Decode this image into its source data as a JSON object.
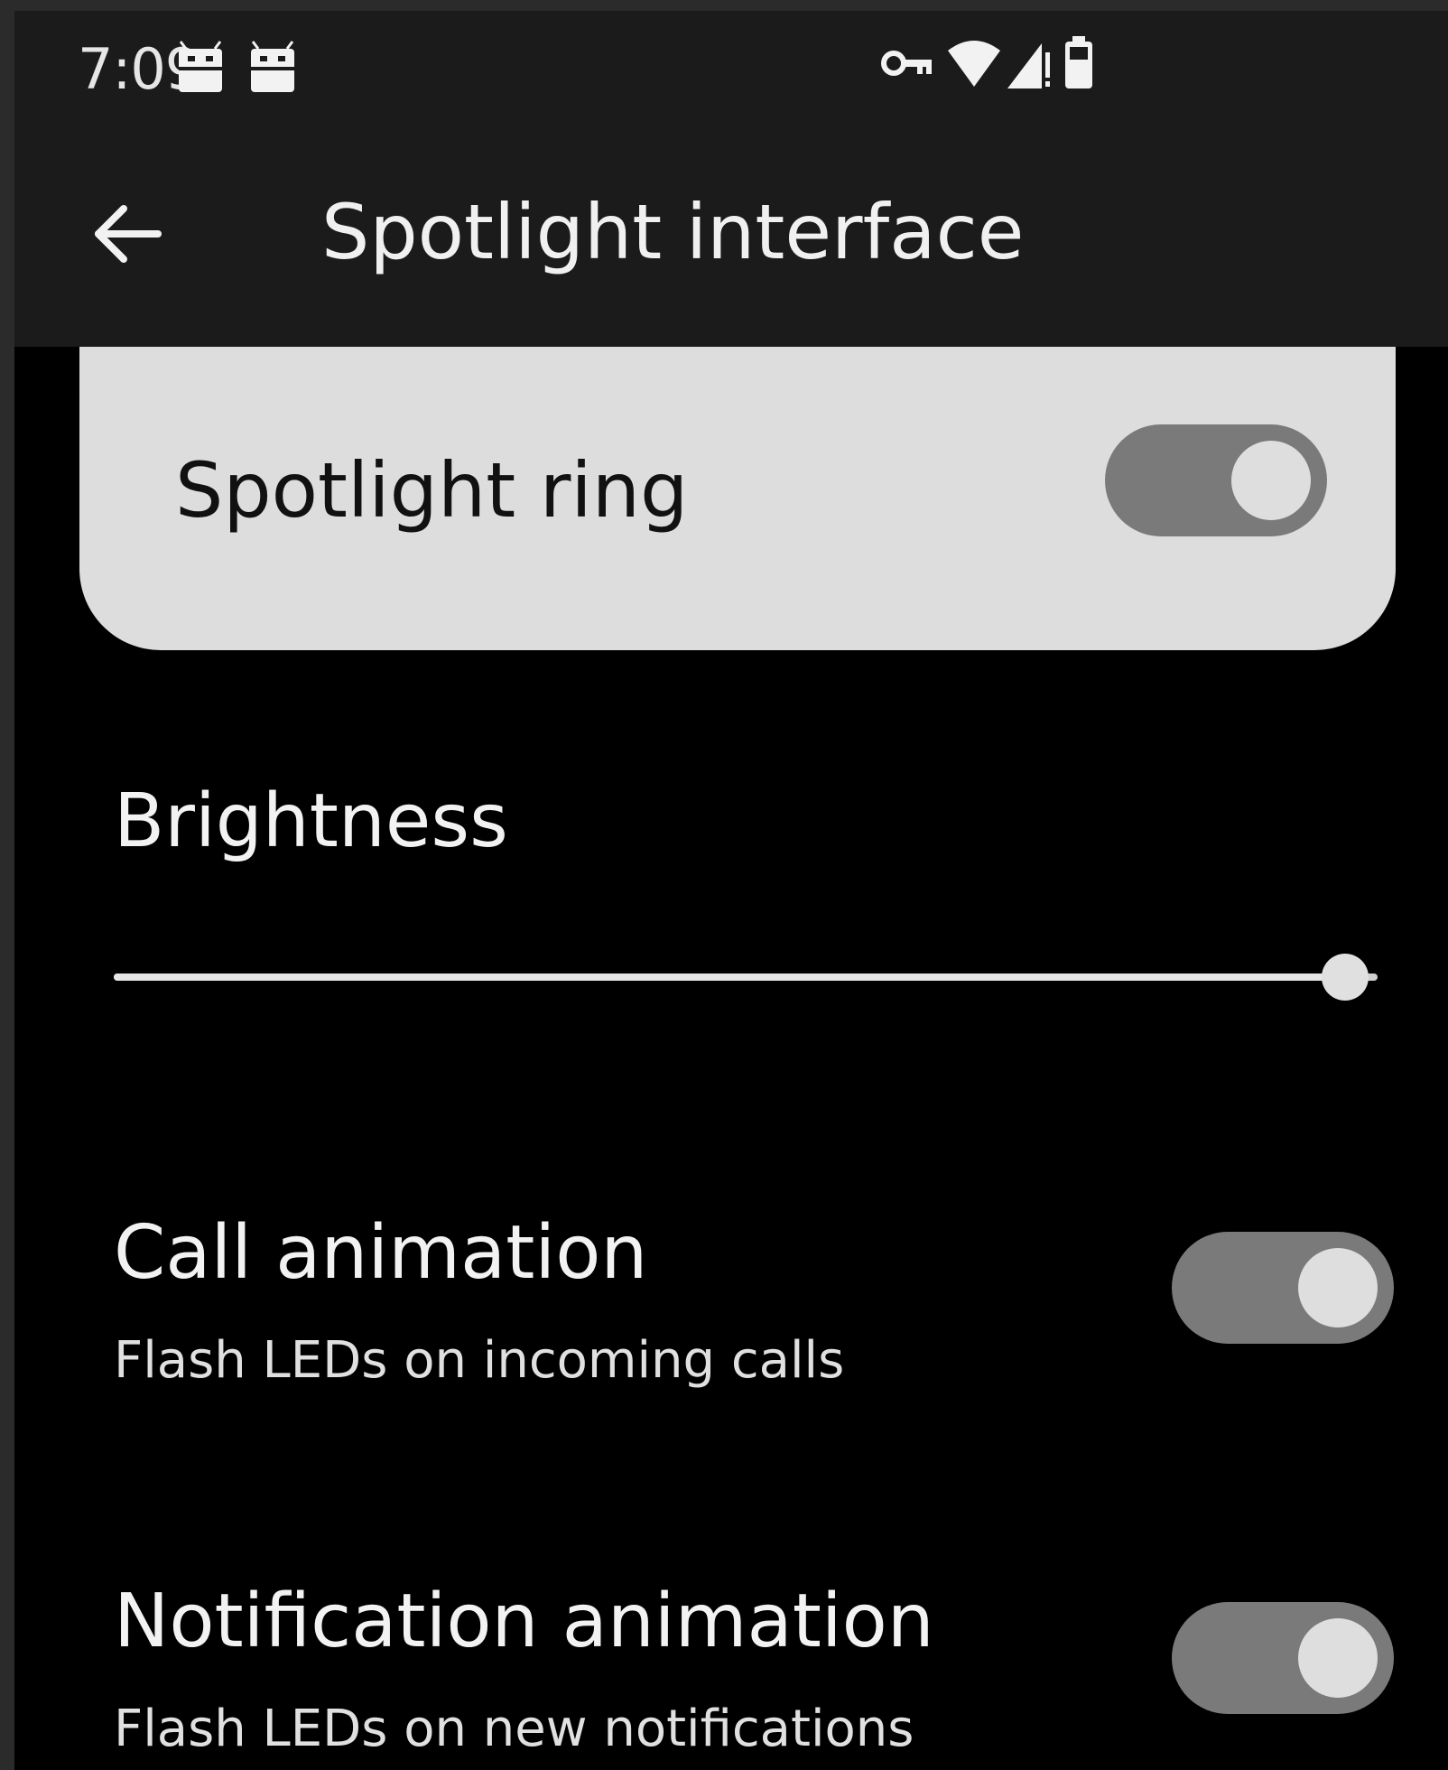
{
  "status_bar": {
    "time": "7:09",
    "left_icons": [
      "android-notification-icon",
      "android-notification-icon"
    ],
    "right_icons": [
      "vpn-key-icon",
      "wifi-icon",
      "cellular-signal-icon",
      "battery-icon"
    ]
  },
  "app_bar": {
    "back_icon": "arrow-back-icon",
    "title": "Spotlight interface"
  },
  "main_switch": {
    "label": "Spotlight ring",
    "checked": true
  },
  "brightness": {
    "label": "Brightness",
    "value_fraction": 1.0
  },
  "preferences": [
    {
      "title": "Call animation",
      "summary": "Flash LEDs on incoming calls",
      "checked": true
    },
    {
      "title": "Notification animation",
      "summary": "Flash LEDs on new notifications",
      "checked": true
    }
  ],
  "colors": {
    "bar_background": "#1b1b1b",
    "page_background": "#000000",
    "card_background": "#dddddd",
    "toggle_track": "#7a7a7a",
    "toggle_knob": "#dedede"
  }
}
